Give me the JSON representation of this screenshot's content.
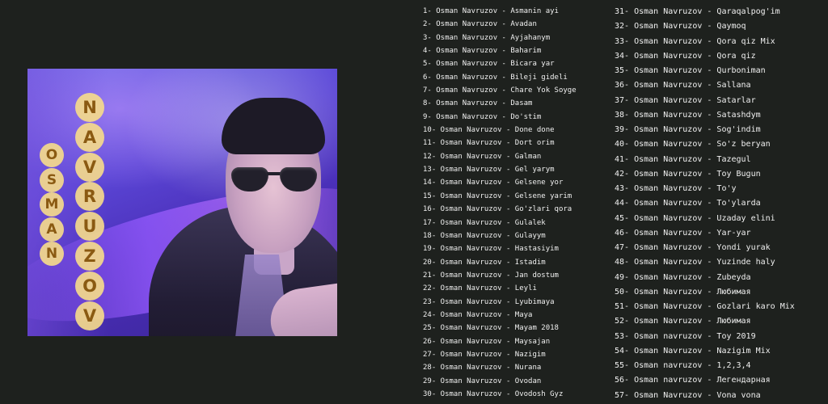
{
  "cover": {
    "surname_letters": [
      "N",
      "A",
      "V",
      "R",
      "U",
      "Z",
      "O",
      "V"
    ],
    "firstname_letters": [
      "O",
      "S",
      "M",
      "A",
      "N"
    ]
  },
  "tracks": {
    "left": [
      "1- Osman Navruzov - Asmanin ayi",
      "2- Osman Navruzov - Avadan",
      "3- Osman Navruzov - Ayjahanym",
      "4- Osman Navruzov - Baharim",
      "5- Osman Navruzov - Bicara yar",
      "6- Osman Navruzov - Bileji gideli",
      "7- Osman Navruzov - Chare Yok Soyge",
      "8- Osman Navruzov - Dasam",
      "9- Osman Navruzov - Do'stim",
      "10- Osman Navruzov - Done done",
      "11- Osman Navruzov - Dort orim",
      "12- Osman Navruzov - Galman",
      "13- Osman Navruzov - Gel yarym",
      "14- Osman Navruzov - Gelsene yor",
      "15- Osman Navruzov - Gelsene yarim",
      "16- Osman Navruzov - Go'zlari qora",
      "17- Osman Navruzov - Gulalek",
      "18- Osman Navruzov - Gulayym",
      "19- Osman Navruzov - Hastasiyim",
      "20- Osman Navruzov - Istadim",
      "21- Osman Navruzov - Jan dostum",
      "22- Osman Navruzov - Leyli",
      "23- Osman Navruzov - Lyubimaya",
      "24- Osman Navruzov - Maya",
      "25- Osman Navruzov - Mayam 2018",
      "26- Osman Navruzov - Maysajan",
      "27- Osman Navruzov - Nazigim",
      "28- Osman Navruzov - Nurana",
      "29- Osman Navruzov - Ovodan",
      "30- Osman Navruzov - Ovodosh Gyz"
    ],
    "right": [
      "31- Osman Navruzov - Qaraqalpog'im",
      "32- Osman Navruzov - Qaymoq",
      "33- Osman Navruzov - Qora qiz Mix",
      "34- Osman Navruzov - Qora qiz",
      "35- Osman Navruzov - Qurboniman",
      "36- Osman Navruzov - Sallana",
      "37- Osman Navruzov - Satarlar",
      "38- Osman Navruzov - Satashdym",
      "39- Osman Navruzov - Sog'indim",
      "40- Osman Navruzov - So'z beryan",
      "41- Osman Navruzov - Tazegul",
      "42- Osman Navruzov - Toy Bugun",
      "43- Osman Navruzov - To'y",
      "44- Osman Navruzov - To'ylarda",
      "45- Osman Navruzov - Uzaday elini",
      "46- Osman Navruzov - Yar-yar",
      "47- Osman Navruzov - Yondi yurak",
      "48- Osman Navruzov - Yuzinde haly",
      "49- Osman Navruzov - Zubeyda",
      "50- Osman Navruzov - Любимая",
      "51- Osman Navruzov - Gozlari karo Mix",
      "52- Osman Navruzov - Любимая",
      "53- Osman navruzov - Toy 2019",
      "54- Osman Navruzov - Nazigim Mix",
      "55- Osman navruzov - 1,2,3,4",
      "56- Osman navruzov - Легендарная",
      "57- Osman Navruzov - Vona vona"
    ]
  }
}
